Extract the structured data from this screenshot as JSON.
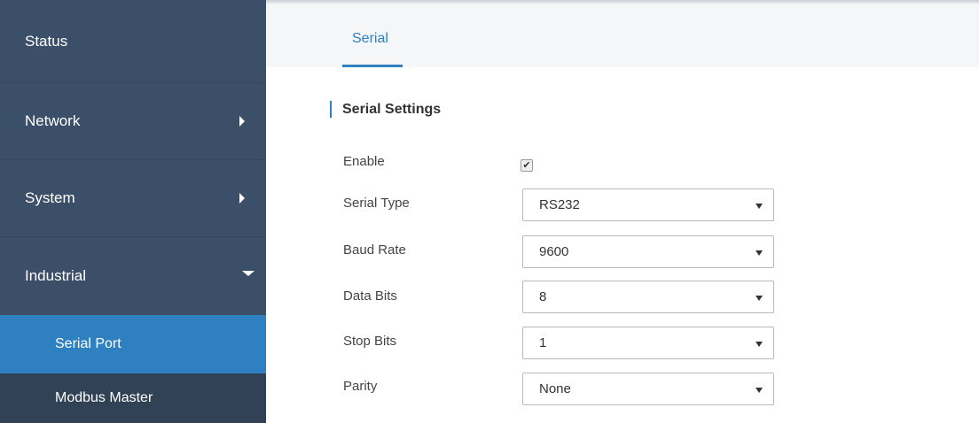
{
  "sidebar": {
    "items": [
      {
        "label": "Status"
      },
      {
        "label": "Network"
      },
      {
        "label": "System"
      },
      {
        "label": "Industrial"
      }
    ],
    "subitems": [
      {
        "label": "Serial Port"
      },
      {
        "label": "Modbus Master"
      }
    ]
  },
  "tabs": [
    {
      "label": "Serial"
    }
  ],
  "section": {
    "title": "Serial Settings"
  },
  "form": {
    "enable": {
      "label": "Enable",
      "checked": true,
      "mark": "✔"
    },
    "serial_type": {
      "label": "Serial Type",
      "value": "RS232"
    },
    "baud_rate": {
      "label": "Baud Rate",
      "value": "9600"
    },
    "data_bits": {
      "label": "Data Bits",
      "value": "8"
    },
    "stop_bits": {
      "label": "Stop Bits",
      "value": "1"
    },
    "parity": {
      "label": "Parity",
      "value": "None"
    }
  },
  "colors": {
    "sidebar": "#3c4f68",
    "accent": "#2f80c1"
  }
}
